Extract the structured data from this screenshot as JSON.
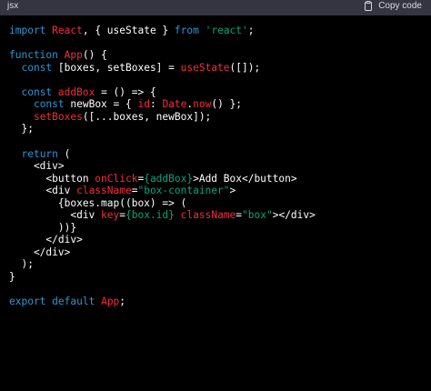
{
  "header": {
    "language": "jsx",
    "copy_label": "Copy code",
    "copy_icon": "clipboard-icon"
  },
  "colors": {
    "keyword": "#2e95d3",
    "function": "#f22c3d",
    "string": "#00a67d",
    "text": "#ffffff"
  },
  "code": [
    [
      [
        "kw",
        "import"
      ],
      [
        "tx",
        " "
      ],
      [
        "fn",
        "React"
      ],
      [
        "tx",
        ", { useState } "
      ],
      [
        "kw",
        "from"
      ],
      [
        "tx",
        " "
      ],
      [
        "st",
        "'react'"
      ],
      [
        "tx",
        ";"
      ]
    ],
    [],
    [
      [
        "kw",
        "function"
      ],
      [
        "tx",
        " "
      ],
      [
        "fn",
        "App"
      ],
      [
        "tx",
        "() {"
      ]
    ],
    [
      [
        "tx",
        "  "
      ],
      [
        "kw",
        "const"
      ],
      [
        "tx",
        " [boxes, setBoxes] = "
      ],
      [
        "fn",
        "useState"
      ],
      [
        "tx",
        "([]);"
      ]
    ],
    [],
    [
      [
        "tx",
        "  "
      ],
      [
        "kw",
        "const"
      ],
      [
        "tx",
        " "
      ],
      [
        "fn",
        "addBox"
      ],
      [
        "tx",
        " = () => {"
      ]
    ],
    [
      [
        "tx",
        "    "
      ],
      [
        "kw",
        "const"
      ],
      [
        "tx",
        " newBox = { "
      ],
      [
        "fn",
        "id"
      ],
      [
        "tx",
        ": "
      ],
      [
        "fn",
        "Date"
      ],
      [
        "tx",
        "."
      ],
      [
        "fn",
        "now"
      ],
      [
        "tx",
        "() };"
      ]
    ],
    [
      [
        "tx",
        "    "
      ],
      [
        "fn",
        "setBoxes"
      ],
      [
        "tx",
        "([...boxes, newBox]);"
      ]
    ],
    [
      [
        "tx",
        "  };"
      ]
    ],
    [],
    [
      [
        "tx",
        "  "
      ],
      [
        "kw",
        "return"
      ],
      [
        "tx",
        " ("
      ]
    ],
    [
      [
        "tx",
        "    <div>"
      ]
    ],
    [
      [
        "tx",
        "      <button "
      ],
      [
        "fn",
        "onClick"
      ],
      [
        "tx",
        "="
      ],
      [
        "st",
        "{addBox}"
      ],
      [
        "tx",
        ">Add Box</button>"
      ]
    ],
    [
      [
        "tx",
        "      <div "
      ],
      [
        "fn",
        "className"
      ],
      [
        "tx",
        "="
      ],
      [
        "st",
        "\"box-container\""
      ],
      [
        "tx",
        ">"
      ]
    ],
    [
      [
        "tx",
        "        {boxes.map((box) => ("
      ]
    ],
    [
      [
        "tx",
        "          <div "
      ],
      [
        "fn",
        "key"
      ],
      [
        "tx",
        "="
      ],
      [
        "st",
        "{box.id}"
      ],
      [
        "tx",
        " "
      ],
      [
        "fn",
        "className"
      ],
      [
        "tx",
        "="
      ],
      [
        "st",
        "\"box\""
      ],
      [
        "tx",
        "></div>"
      ]
    ],
    [
      [
        "tx",
        "        ))}"
      ]
    ],
    [
      [
        "tx",
        "      </div>"
      ]
    ],
    [
      [
        "tx",
        "    </div>"
      ]
    ],
    [
      [
        "tx",
        "  );"
      ]
    ],
    [
      [
        "tx",
        "}"
      ]
    ],
    [],
    [
      [
        "kw",
        "export"
      ],
      [
        "tx",
        " "
      ],
      [
        "kw",
        "default"
      ],
      [
        "tx",
        " "
      ],
      [
        "fn",
        "App"
      ],
      [
        "tx",
        ";"
      ]
    ]
  ]
}
